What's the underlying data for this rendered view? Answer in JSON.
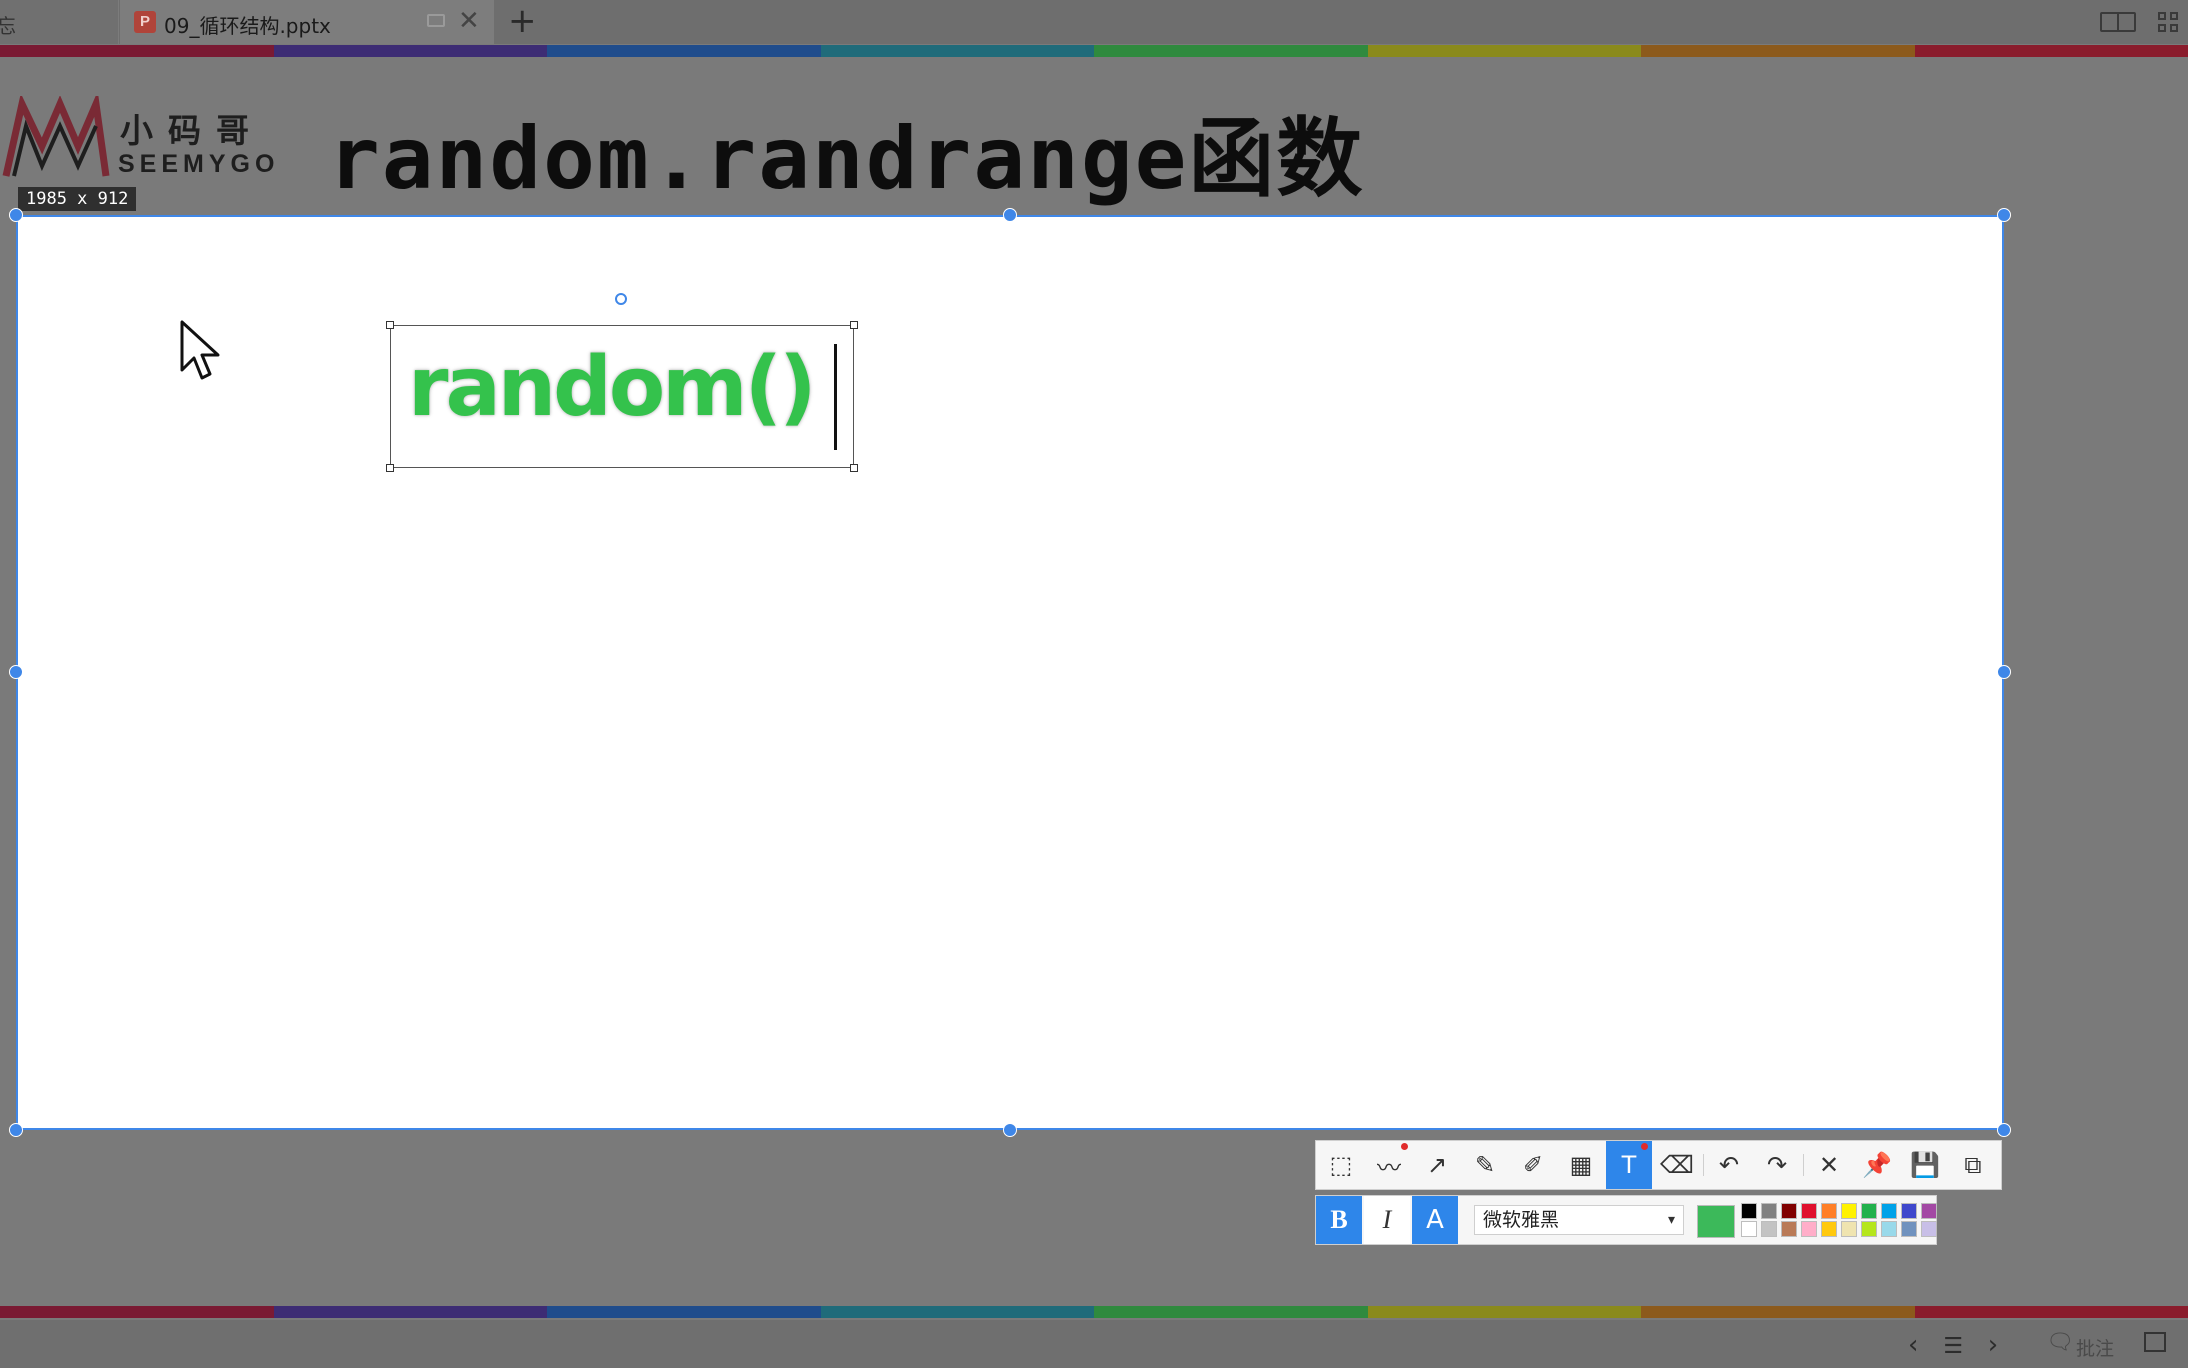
{
  "tabs": {
    "previous_tab_label": "忘",
    "active_tab_title": "09_循环结构.pptx",
    "add_tab": "+",
    "close_tab": "✕"
  },
  "slide": {
    "logo_cn": "小码哥",
    "logo_en": "SEEMYGO",
    "title": "random.randrange函数"
  },
  "capture": {
    "size_label": "1985 x 912",
    "text_box_content": "random()"
  },
  "toolbar": {
    "tools": [
      {
        "name": "rectangle-ellipse-tool",
        "glyph": "⬚",
        "dot": false
      },
      {
        "name": "polyline-tool",
        "glyph": "〰",
        "dot": true
      },
      {
        "name": "arrow-tool",
        "glyph": "↗",
        "dot": false
      },
      {
        "name": "pencil-tool",
        "glyph": "✎",
        "dot": false
      },
      {
        "name": "highlighter-tool",
        "glyph": "✐",
        "dot": false
      },
      {
        "name": "mosaic-tool",
        "glyph": "▦",
        "dot": false
      },
      {
        "name": "text-tool",
        "glyph": "T",
        "dot": true,
        "active": true
      },
      {
        "name": "eraser-tool",
        "glyph": "⌫",
        "dot": false
      },
      {
        "name": "undo-button",
        "glyph": "↶",
        "dot": false
      },
      {
        "name": "redo-button",
        "glyph": "↷",
        "dot": false
      },
      {
        "name": "cancel-button",
        "glyph": "✕",
        "dot": false
      },
      {
        "name": "pin-button",
        "glyph": "📌",
        "dot": false
      },
      {
        "name": "save-button",
        "glyph": "💾",
        "dot": false
      },
      {
        "name": "copy-button",
        "glyph": "⧉",
        "dot": false
      }
    ],
    "bold_label": "B",
    "italic_label": "I",
    "outline_label": "A",
    "font_name": "微软雅黑",
    "current_color": "#3cb95a",
    "palette_top": [
      "#000000",
      "#808080",
      "#800000",
      "#e0102e",
      "#ff7f27",
      "#fff200",
      "#22b14c",
      "#00a2e8",
      "#3f48cc",
      "#a349a4"
    ],
    "palette_bottom": [
      "#ffffff",
      "#c3c3c3",
      "#b97a57",
      "#ffaec9",
      "#ffc90e",
      "#efe4b0",
      "#b5e61d",
      "#99d9ea",
      "#7092be",
      "#c8bfe7"
    ]
  },
  "statusbar": {
    "annotate_label": "批注"
  }
}
